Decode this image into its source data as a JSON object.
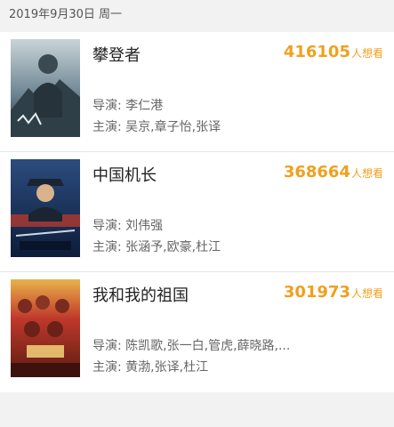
{
  "header": {
    "date": "2019年9月30日 周一"
  },
  "movies": [
    {
      "title": "攀登者",
      "want_count": "416105",
      "want_unit": "人想看",
      "director_label": "导演: ",
      "director": "李仁港",
      "cast_label": "主演: ",
      "cast": "吴京,章子怡,张译",
      "poster": {
        "icon": "poster-mountain-climber",
        "palette": [
          "#1d2a33",
          "#4a6473",
          "#c9d4d8"
        ]
      }
    },
    {
      "title": "中国机长",
      "want_count": "368664",
      "want_unit": "人想看",
      "director_label": "导演: ",
      "director": "刘伟强",
      "cast_label": "主演: ",
      "cast": "张涵予,欧豪,杜江",
      "poster": {
        "icon": "poster-captain",
        "palette": [
          "#0d1d3a",
          "#2b4c7e",
          "#b23a2e"
        ]
      }
    },
    {
      "title": "我和我的祖国",
      "want_count": "301973",
      "want_unit": "人想看",
      "director_label": "导演: ",
      "director": "陈凯歌,张一白,管虎,薛晓路,...",
      "cast_label": "主演: ",
      "cast": "黄渤,张译,杜江",
      "poster": {
        "icon": "poster-motherland-crowd",
        "palette": [
          "#5a1a12",
          "#c0392b",
          "#e8b24a"
        ]
      }
    }
  ],
  "colors": {
    "accent": "#f0a01e",
    "background": "#f2f2f2"
  }
}
